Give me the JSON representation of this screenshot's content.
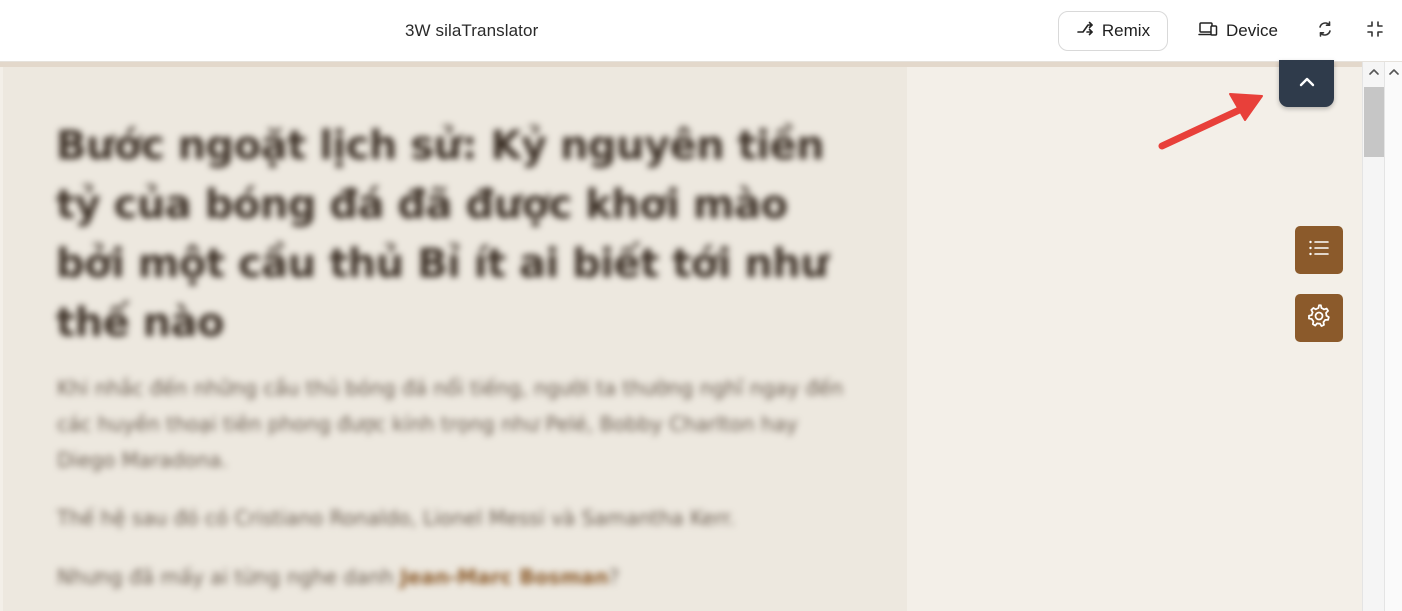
{
  "header": {
    "title": "3W silaTranslator",
    "remix_label": "Remix",
    "device_label": "Device"
  },
  "article": {
    "heading": "Bước ngoặt lịch sử: Kỷ nguyên tiền tỷ của bóng đá đã được khơi mào bởi một cầu thủ Bỉ ít ai biết tới như thế nào",
    "paragraph_1": "Khi nhắc đến những cầu thủ bóng đá nổi tiếng, người ta thường nghĩ ngay đến các huyền thoại tiên phong được kính trọng như Pelé, Bobby Charlton hay Diego Maradona.",
    "paragraph_2": "Thế hệ sau đó có Cristiano Ronaldo, Lionel Messi và Samantha Kerr.",
    "paragraph_3_prefix": "Nhưng đã mấy ai từng nghe danh ",
    "paragraph_3_name": "Jean-Marc Bosman",
    "paragraph_3_suffix": "?"
  },
  "icons": {
    "remix": "remix-icon",
    "device": "device-icon",
    "rotate": "rotate-icon",
    "exit_fullscreen": "exit-fullscreen-icon",
    "scroll_top": "chevron-up-icon",
    "toc": "list-icon",
    "settings": "gear-icon",
    "annotation": "red-arrow-icon"
  },
  "colors": {
    "accent_brown": "#8b5a2b",
    "scroll_top_bg": "#2f3b4b",
    "page_bg": "#f3efe8",
    "article_bg": "#ede8df",
    "annotation_red": "#e8403a"
  }
}
